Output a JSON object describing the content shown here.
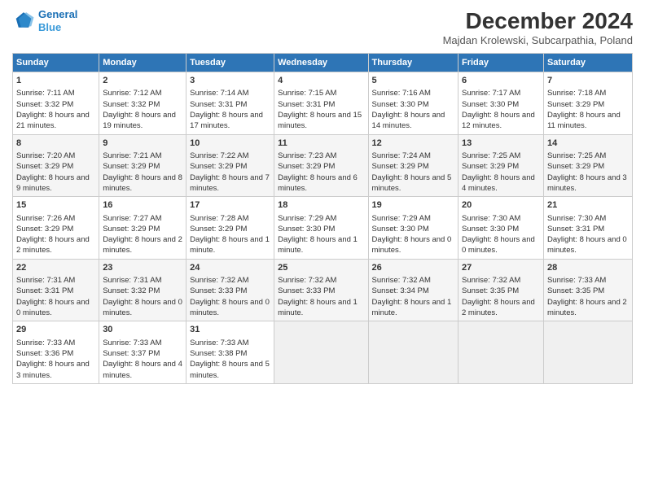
{
  "logo": {
    "line1": "General",
    "line2": "Blue"
  },
  "title": "December 2024",
  "subtitle": "Majdan Krolewski, Subcarpathia, Poland",
  "headers": [
    "Sunday",
    "Monday",
    "Tuesday",
    "Wednesday",
    "Thursday",
    "Friday",
    "Saturday"
  ],
  "weeks": [
    [
      {
        "day": "1",
        "sunrise": "7:11 AM",
        "sunset": "3:32 PM",
        "daylight": "8 hours and 21 minutes."
      },
      {
        "day": "2",
        "sunrise": "7:12 AM",
        "sunset": "3:32 PM",
        "daylight": "8 hours and 19 minutes."
      },
      {
        "day": "3",
        "sunrise": "7:14 AM",
        "sunset": "3:31 PM",
        "daylight": "8 hours and 17 minutes."
      },
      {
        "day": "4",
        "sunrise": "7:15 AM",
        "sunset": "3:31 PM",
        "daylight": "8 hours and 15 minutes."
      },
      {
        "day": "5",
        "sunrise": "7:16 AM",
        "sunset": "3:30 PM",
        "daylight": "8 hours and 14 minutes."
      },
      {
        "day": "6",
        "sunrise": "7:17 AM",
        "sunset": "3:30 PM",
        "daylight": "8 hours and 12 minutes."
      },
      {
        "day": "7",
        "sunrise": "7:18 AM",
        "sunset": "3:29 PM",
        "daylight": "8 hours and 11 minutes."
      }
    ],
    [
      {
        "day": "8",
        "sunrise": "7:20 AM",
        "sunset": "3:29 PM",
        "daylight": "8 hours and 9 minutes."
      },
      {
        "day": "9",
        "sunrise": "7:21 AM",
        "sunset": "3:29 PM",
        "daylight": "8 hours and 8 minutes."
      },
      {
        "day": "10",
        "sunrise": "7:22 AM",
        "sunset": "3:29 PM",
        "daylight": "8 hours and 7 minutes."
      },
      {
        "day": "11",
        "sunrise": "7:23 AM",
        "sunset": "3:29 PM",
        "daylight": "8 hours and 6 minutes."
      },
      {
        "day": "12",
        "sunrise": "7:24 AM",
        "sunset": "3:29 PM",
        "daylight": "8 hours and 5 minutes."
      },
      {
        "day": "13",
        "sunrise": "7:25 AM",
        "sunset": "3:29 PM",
        "daylight": "8 hours and 4 minutes."
      },
      {
        "day": "14",
        "sunrise": "7:25 AM",
        "sunset": "3:29 PM",
        "daylight": "8 hours and 3 minutes."
      }
    ],
    [
      {
        "day": "15",
        "sunrise": "7:26 AM",
        "sunset": "3:29 PM",
        "daylight": "8 hours and 2 minutes."
      },
      {
        "day": "16",
        "sunrise": "7:27 AM",
        "sunset": "3:29 PM",
        "daylight": "8 hours and 2 minutes."
      },
      {
        "day": "17",
        "sunrise": "7:28 AM",
        "sunset": "3:29 PM",
        "daylight": "8 hours and 1 minute."
      },
      {
        "day": "18",
        "sunrise": "7:29 AM",
        "sunset": "3:30 PM",
        "daylight": "8 hours and 1 minute."
      },
      {
        "day": "19",
        "sunrise": "7:29 AM",
        "sunset": "3:30 PM",
        "daylight": "8 hours and 0 minutes."
      },
      {
        "day": "20",
        "sunrise": "7:30 AM",
        "sunset": "3:30 PM",
        "daylight": "8 hours and 0 minutes."
      },
      {
        "day": "21",
        "sunrise": "7:30 AM",
        "sunset": "3:31 PM",
        "daylight": "8 hours and 0 minutes."
      }
    ],
    [
      {
        "day": "22",
        "sunrise": "7:31 AM",
        "sunset": "3:31 PM",
        "daylight": "8 hours and 0 minutes."
      },
      {
        "day": "23",
        "sunrise": "7:31 AM",
        "sunset": "3:32 PM",
        "daylight": "8 hours and 0 minutes."
      },
      {
        "day": "24",
        "sunrise": "7:32 AM",
        "sunset": "3:33 PM",
        "daylight": "8 hours and 0 minutes."
      },
      {
        "day": "25",
        "sunrise": "7:32 AM",
        "sunset": "3:33 PM",
        "daylight": "8 hours and 1 minute."
      },
      {
        "day": "26",
        "sunrise": "7:32 AM",
        "sunset": "3:34 PM",
        "daylight": "8 hours and 1 minute."
      },
      {
        "day": "27",
        "sunrise": "7:32 AM",
        "sunset": "3:35 PM",
        "daylight": "8 hours and 2 minutes."
      },
      {
        "day": "28",
        "sunrise": "7:33 AM",
        "sunset": "3:35 PM",
        "daylight": "8 hours and 2 minutes."
      }
    ],
    [
      {
        "day": "29",
        "sunrise": "7:33 AM",
        "sunset": "3:36 PM",
        "daylight": "8 hours and 3 minutes."
      },
      {
        "day": "30",
        "sunrise": "7:33 AM",
        "sunset": "3:37 PM",
        "daylight": "8 hours and 4 minutes."
      },
      {
        "day": "31",
        "sunrise": "7:33 AM",
        "sunset": "3:38 PM",
        "daylight": "8 hours and 5 minutes."
      },
      null,
      null,
      null,
      null
    ]
  ],
  "labels": {
    "sunrise": "Sunrise:",
    "sunset": "Sunset:",
    "daylight": "Daylight:"
  }
}
